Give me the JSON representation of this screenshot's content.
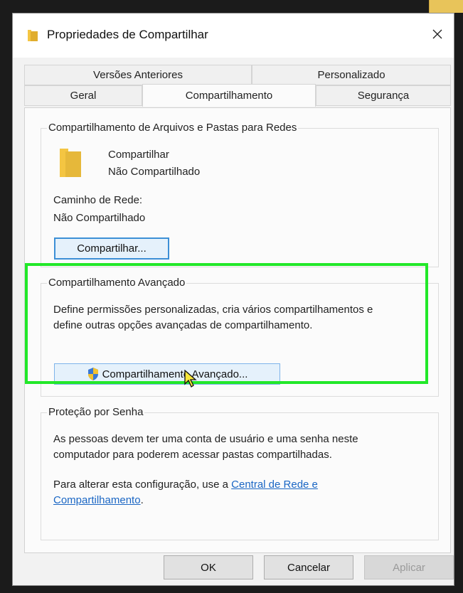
{
  "window": {
    "title": "Propriedades de Compartilhar",
    "close_icon": "close-icon"
  },
  "tabs": {
    "row1": [
      "Versões Anteriores",
      "Personalizado"
    ],
    "row2": [
      "Geral",
      "Compartilhamento",
      "Segurança"
    ],
    "active": "Compartilhamento"
  },
  "network_sharing": {
    "group_title": "Compartilhamento de Arquivos e Pastas para Redes",
    "folder_name": "Compartilhar",
    "folder_status": "Não Compartilhado",
    "path_label": "Caminho de Rede:",
    "path_value": "Não Compartilhado",
    "share_button": "Compartilhar..."
  },
  "advanced_sharing": {
    "group_title": "Compartilhamento Avançado",
    "description_line1": "Define permissões personalizadas, cria vários compartilhamentos e",
    "description_line2": "define outras opções avançadas de compartilhamento.",
    "button_label": "Compartilhamento Avançado..."
  },
  "password_protection": {
    "group_title": "Proteção por Senha",
    "description_line1": "As pessoas devem ter uma conta de usuário e uma senha neste",
    "description_line2": "computador para poderem acessar pastas compartilhadas.",
    "change_text": "Para alterar esta configuração, use a",
    "link_part1": "Central de Rede e",
    "link_part2": "Compartilhamento",
    "link_suffix": "."
  },
  "buttons": {
    "ok": "OK",
    "cancel": "Cancelar",
    "apply": "Aplicar"
  },
  "colors": {
    "highlight": "#22e829",
    "link": "#1a66c4",
    "focus": "#3c8fd6"
  }
}
